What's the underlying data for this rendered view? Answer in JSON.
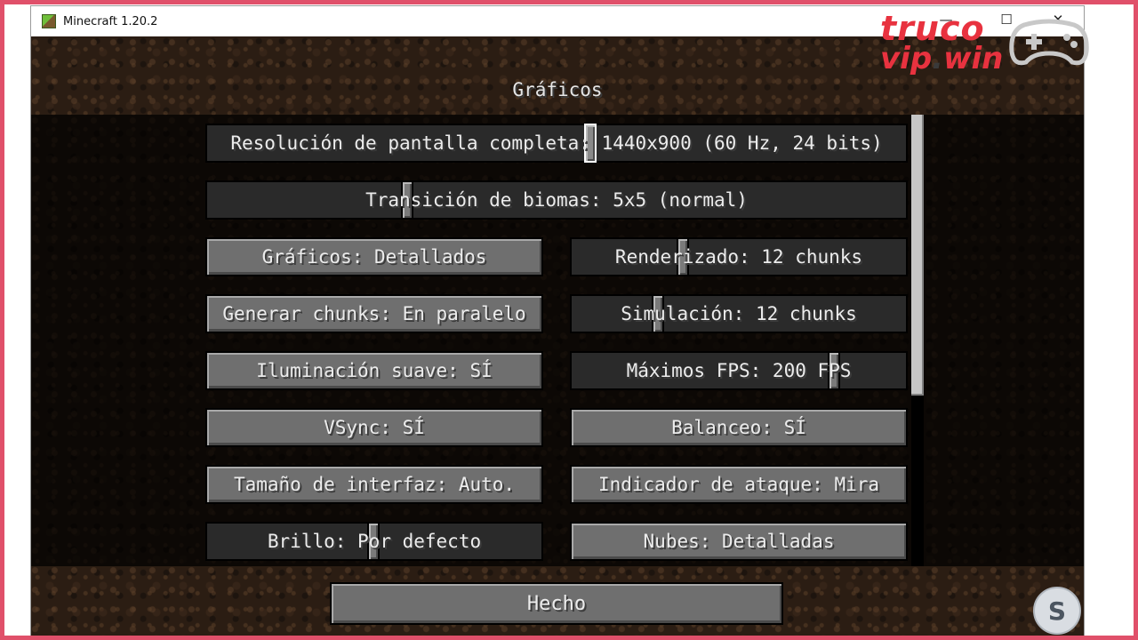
{
  "window": {
    "title": "Minecraft 1.20.2",
    "minimize": "—",
    "maximize": "☐",
    "close": "✕"
  },
  "screen": {
    "title": "Gráficos"
  },
  "options": {
    "fullscreen_resolution": "Resolución de pantalla completa: 1440x900 (60 Hz, 24 bits)",
    "biome_blend": "Transición de biomas: 5x5 (normal)",
    "graphics": "Gráficos: Detallados",
    "render_distance": "Renderizado: 12 chunks",
    "chunk_builder": "Generar chunks: En paralelo",
    "simulation_distance": "Simulación: 12 chunks",
    "smooth_lighting": "Iluminación suave: SÍ",
    "max_fps": "Máximos FPS: 200 FPS",
    "vsync": "VSync: SÍ",
    "view_bobbing": "Balanceo: SÍ",
    "gui_scale": "Tamaño de interfaz: Auto.",
    "attack_indicator": "Indicador de ataque: Mira",
    "brightness": "Brillo: Por defecto",
    "clouds": "Nubes: Detalladas"
  },
  "done_label": "Hecho",
  "watermark": {
    "line1": "truco",
    "line2_a": "vip",
    "line2_dot": ".",
    "line2_b": "win",
    "corner_logo": "S"
  },
  "colors": {
    "frame": "#e0506a",
    "button": "#6f6f6f",
    "slider_track": "#2a2a2a",
    "watermark_red": "#e8323f"
  }
}
